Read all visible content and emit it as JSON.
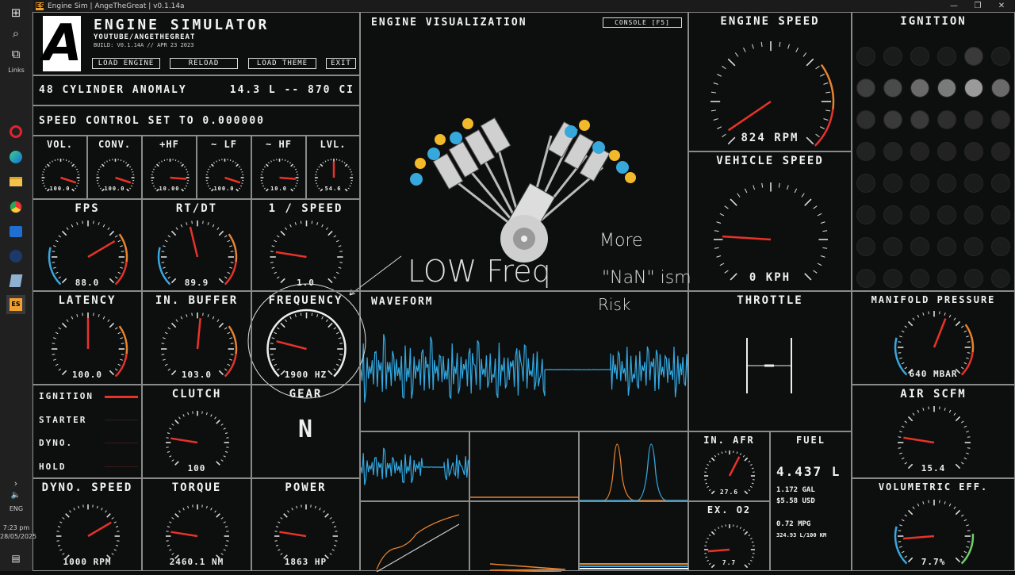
{
  "window": {
    "title": "Engine Sim | AngeTheGreat | v0.1.14a",
    "icon": "ES",
    "controls": [
      "—",
      "❐",
      "✕"
    ]
  },
  "taskbar": {
    "links_label": "Links",
    "language": "ENG",
    "time": "7:23 pm",
    "date": "28/05/2025",
    "icons": [
      "windows-start-icon",
      "search-icon",
      "task-view-icon",
      "opera-icon",
      "edge-icon",
      "file-explorer-icon",
      "chrome-icon",
      "outlook-icon",
      "steam-icon",
      "app-icon",
      "engine-sim-icon"
    ]
  },
  "header": {
    "logo": "A",
    "title": "ENGINE SIMULATOR",
    "subtitle": "YOUTUBE/ANGETHEGREAT",
    "build": "BUILD: V0.1.14A // APR 23 2023",
    "buttons": [
      "LOAD ENGINE",
      "RELOAD",
      "LOAD THEME",
      "EXIT"
    ]
  },
  "engine_info": {
    "name": "48 CYLINDER ANOMALY",
    "displacement": "14.3 L -- 870 CI"
  },
  "speed_control": "SPEED CONTROL SET TO 0.000000",
  "mini_gauges": [
    {
      "title": "VOL.",
      "value": "100.0",
      "level": 0.9
    },
    {
      "title": "CONV.",
      "value": "100.0",
      "level": 0.9
    },
    {
      "title": "+HF",
      "value": "10.00",
      "level": 0.85
    },
    {
      "title": "~ LF",
      "value": "100.0",
      "level": 0.9
    },
    {
      "title": "~ HF",
      "value": "10.0",
      "level": 0.85
    },
    {
      "title": "LVL.",
      "value": "54.6",
      "level": 0.5
    }
  ],
  "mid_gauges": [
    {
      "title": "FPS",
      "value": "88.0",
      "level": 0.72
    },
    {
      "title": "RT/DT",
      "value": "89.9",
      "level": 0.45
    },
    {
      "title": "1 / SPEED",
      "value": "1.0",
      "level": 0.2
    },
    {
      "title": "LATENCY",
      "value": "100.0",
      "level": 0.5
    },
    {
      "title": "IN. BUFFER",
      "value": "103.0",
      "level": 0.52
    },
    {
      "title": "FREQUENCY",
      "value": "1900 HZ",
      "level": 0.22
    }
  ],
  "visualization": {
    "title": "ENGINE VISUALIZATION",
    "console_button": "CONSOLE [F5]"
  },
  "engine_speed": {
    "title": "ENGINE SPEED",
    "value": "824 RPM",
    "level": 0.04
  },
  "vehicle_speed": {
    "title": "VEHICLE SPEED",
    "value": "0 KPH",
    "level": 0.18
  },
  "ignition_panel": {
    "title": "IGNITION"
  },
  "waveform": {
    "title": "WAVEFORM"
  },
  "throttle": {
    "title": "THROTTLE"
  },
  "manifold": {
    "title": "MANIFOLD PRESSURE",
    "value": "640 MBAR",
    "level": 0.58
  },
  "air_scfm": {
    "title": "AIR SCFM",
    "value": "15.4",
    "level": 0.2
  },
  "volumetric": {
    "title": "VOLUMETRIC EFF.",
    "value": "7.7%",
    "level": 0.15
  },
  "in_afr": {
    "title": "IN. AFR",
    "value": "27.6",
    "level": 0.6
  },
  "ex_o2": {
    "title": "EX. O2",
    "value": "7.7",
    "level": 0.15
  },
  "fuel": {
    "title": "FUEL",
    "liters": "4.437 L",
    "gal": "1.172 GAL",
    "usd": "$5.58 USD",
    "mpg": "0.72 MPG",
    "l100": "324.93 L/100 KM"
  },
  "switches": {
    "items": [
      "IGNITION",
      "STARTER",
      "DYNO.",
      "HOLD"
    ],
    "active": [
      true,
      false,
      false,
      false
    ]
  },
  "clutch": {
    "title": "CLUTCH",
    "value": "100",
    "level": 0.2
  },
  "gear": {
    "title": "GEAR",
    "value": "N"
  },
  "dyno_speed": {
    "title": "DYNO. SPEED",
    "value": "1000 RPM",
    "level": 0.72
  },
  "torque": {
    "title": "TORQUE",
    "value": "2460.1 NM",
    "level": 0.2
  },
  "power": {
    "title": "POWER",
    "value": "1863 HP",
    "level": 0.2
  },
  "annotation": {
    "main": "LOW Freq",
    "side_top": "More",
    "side_mid": "\"NaN\" ism",
    "side_bot": "Risk"
  },
  "colors": {
    "accent_red": "#e8332a",
    "accent_orange": "#e8842f",
    "accent_blue": "#3aa8e0",
    "accent_green": "#6fcf6a",
    "panel_border": "#8a8a8a"
  }
}
